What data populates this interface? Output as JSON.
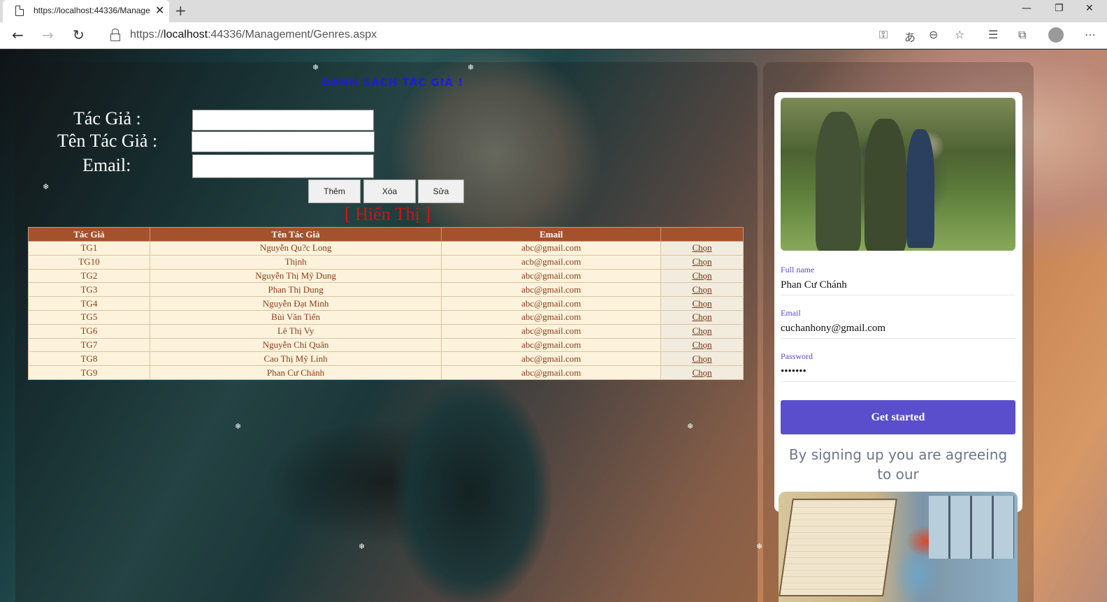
{
  "browser": {
    "tab_title": "https://localhost:44336/Manage",
    "url_scheme": "https://",
    "url_host": "localhost",
    "url_rest": ":44336/Management/Genres.aspx",
    "icons": {
      "back": "arrow-left-icon",
      "forward": "arrow-right-icon",
      "refresh": "refresh-icon",
      "lock": "lock-icon",
      "key": "key-icon",
      "translate": "translate-icon",
      "zoom": "zoom-out-icon",
      "favorite": "star-icon",
      "favorites_bar": "favorites-icon",
      "collections": "collections-icon",
      "profile": "avatar-icon",
      "more": "more-icon"
    }
  },
  "left": {
    "title": "DANH SÁCH TÁC GIẢ !",
    "labels": {
      "author": "Tác Giả :",
      "author_name": "Tên Tác Giả :",
      "email": "Email:"
    },
    "inputs": {
      "author": "",
      "author_name": "",
      "email": ""
    },
    "buttons": {
      "add": "Thêm",
      "delete": "Xóa",
      "edit": "Sửa"
    },
    "show_link": "[ Hiển Thị ]",
    "table": {
      "headers": [
        "Tác Giả",
        "Tên Tác Giả",
        "Email",
        ""
      ],
      "rows": [
        [
          "TG1",
          "Nguyễn Qu?c Long",
          "abc@gmail.com",
          "Chọn"
        ],
        [
          "TG10",
          "Thịnh",
          "acb@gmail.com",
          "Chọn"
        ],
        [
          "TG2",
          "Nguyễn Thị Mỹ Dung",
          "abc@gmail.com",
          "Chọn"
        ],
        [
          "TG3",
          "Phan Thị Dung",
          "abc@gmail.com",
          "Chọn"
        ],
        [
          "TG4",
          "Nguyễn Đạt Minh",
          "abc@gmail.com",
          "Chọn"
        ],
        [
          "TG5",
          "Bùi Văn Tiến",
          "abc@gmail.com",
          "Chọn"
        ],
        [
          "TG6",
          "Lê Thị Vy",
          "abc@gmail.com",
          "Chọn"
        ],
        [
          "TG7",
          "Nguyễn Chí Quân",
          "abc@gmail.com",
          "Chọn"
        ],
        [
          "TG8",
          "Cao Thị Mỹ Linh",
          "abc@gmail.com",
          "Chọn"
        ],
        [
          "TG9",
          "Phan Cư Chánh",
          "abc@gmail.com",
          "Chọn"
        ]
      ]
    }
  },
  "right": {
    "full_name_label": "Full name",
    "full_name": "Phan Cư Chánh",
    "email_label": "Email",
    "email": "cuchanhony@gmail.com",
    "password_label": "Password",
    "password": "•••••••",
    "get_started": "Get started",
    "agree_text": "By signing up you are agreeing to our"
  },
  "colors": {
    "title_blue": "#1d1dd8",
    "header_brown": "#a4522c",
    "cell_bg": "#fdf3dc",
    "cell_text": "#8b3a16",
    "link_red": "#d01414",
    "accent_purple": "#5a4ecc"
  }
}
